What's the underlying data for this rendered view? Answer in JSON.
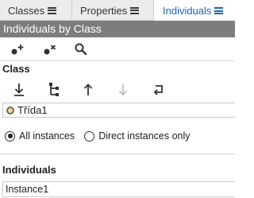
{
  "tabs": [
    {
      "label": "Classes",
      "icon": "menu-icon",
      "active": false
    },
    {
      "label": "Properties",
      "icon": "menu-icon",
      "active": false
    },
    {
      "label": "Individuals",
      "icon": "menu-icon",
      "active": true
    }
  ],
  "panel": {
    "title": "Individuals by Class"
  },
  "toolbar": {
    "add_icon": "add-individual-icon",
    "delete_icon": "delete-individual-icon",
    "search_icon": "search-icon"
  },
  "class_section": {
    "title": "Class",
    "hierarchy_icons": [
      "expand-down-icon",
      "hierarchy-icon",
      "up-icon",
      "down-disabled-icon",
      "return-icon"
    ],
    "selected_class": "Třída1"
  },
  "instances_filter": {
    "options": [
      {
        "label": "All instances",
        "selected": true
      },
      {
        "label": "Direct instances only",
        "selected": false
      }
    ]
  },
  "individuals_section": {
    "title": "Individuals",
    "items": [
      "Instance1"
    ]
  },
  "colors": {
    "accent": "#1a66b8",
    "titlebar": "#7d7d7d",
    "class_dot": "#f4dc8a"
  }
}
